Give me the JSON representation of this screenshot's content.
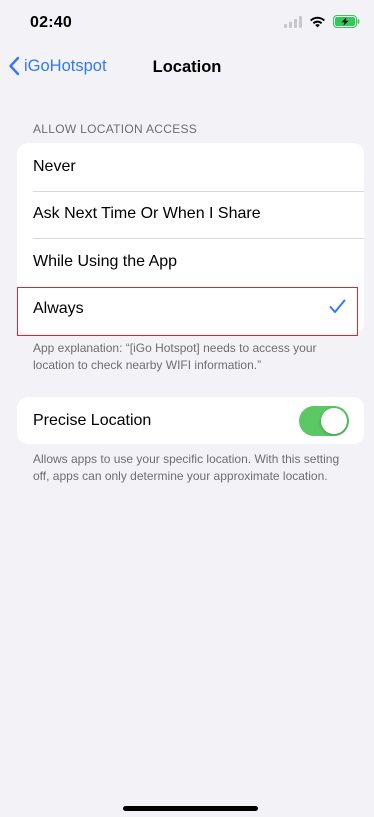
{
  "status_bar": {
    "time": "02:40",
    "icons": [
      "signal-icon",
      "wifi-icon",
      "battery-charging-icon"
    ]
  },
  "nav": {
    "back_label": "iGoHotspot",
    "title": "Location"
  },
  "location_access": {
    "header": "ALLOW LOCATION ACCESS",
    "options": [
      {
        "label": "Never",
        "selected": false
      },
      {
        "label": "Ask Next Time Or When I Share",
        "selected": false
      },
      {
        "label": "While Using the App",
        "selected": false
      },
      {
        "label": "Always",
        "selected": true
      }
    ],
    "footer": "App explanation: “[iGo Hotspot] needs to access your location to check nearby WIFI information.”"
  },
  "precise_location": {
    "label": "Precise Location",
    "enabled": true,
    "footer": "Allows apps to use your specific location. With this setting off, apps can only determine your approximate location."
  },
  "colors": {
    "accent": "#3478f6",
    "toggle_on": "#5bc765",
    "highlight_border": "#d9282f",
    "background": "#f2f2f7"
  }
}
